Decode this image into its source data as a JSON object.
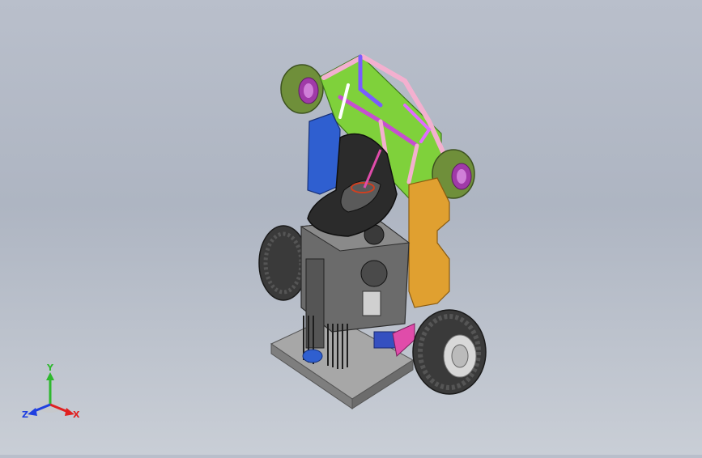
{
  "app": {
    "title": ""
  },
  "viewport": {
    "background_top": "#b9bfcb",
    "background_bottom": "#c9ced6",
    "model": {
      "parts": [
        {
          "name": "rear-left-wheel",
          "color": "#6f8f3a"
        },
        {
          "name": "rear-right-wheel",
          "color": "#6f8f3a"
        },
        {
          "name": "front-left-wheel",
          "color": "#3a3a3a"
        },
        {
          "name": "front-right-wheel",
          "color": "#3a3a3a"
        },
        {
          "name": "chassis-panel",
          "color": "#7fd13b"
        },
        {
          "name": "seat",
          "color": "#2b2b2b"
        },
        {
          "name": "engine",
          "color": "#6b6b6b"
        },
        {
          "name": "fuel-tank",
          "color": "#e0a030"
        },
        {
          "name": "side-pod",
          "color": "#2f5fd0"
        },
        {
          "name": "base-plate",
          "color": "#9a9a9a"
        },
        {
          "name": "frame-tubes",
          "color": "#f0a0c8"
        }
      ]
    }
  },
  "triad": {
    "y_label": "Y",
    "z_label": "Z",
    "x_label": "X",
    "y_color": "#2eb82e",
    "x_color": "#e02020",
    "z_color": "#2040e0"
  }
}
